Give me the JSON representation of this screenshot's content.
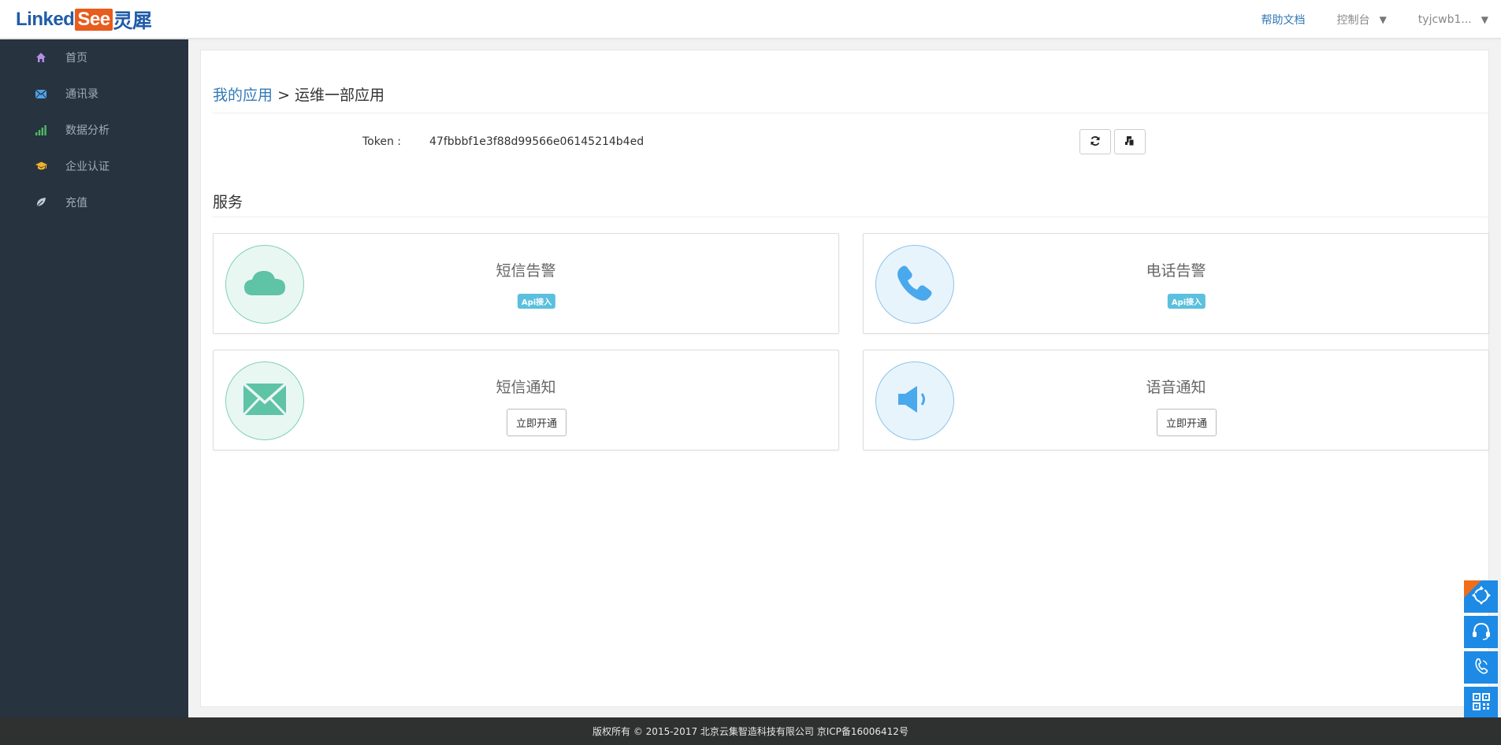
{
  "header": {
    "logo": {
      "part1": "Linked",
      "part2": "See",
      "part3": "灵犀"
    },
    "nav": {
      "help": "帮助文档",
      "console": "控制台",
      "user": "tyjcwb1..."
    }
  },
  "sidebar": {
    "items": [
      {
        "label": "首页",
        "icon": "home-icon",
        "color": "#b58fe6"
      },
      {
        "label": "通讯录",
        "icon": "envelope-icon",
        "color": "#4fa3e8"
      },
      {
        "label": "数据分析",
        "icon": "signal-bars-icon",
        "color": "#4cbb5f"
      },
      {
        "label": "企业认证",
        "icon": "graduation-cap-icon",
        "color": "#f0b429"
      },
      {
        "label": "充值",
        "icon": "leaf-icon",
        "color": "#c2ccd4"
      }
    ]
  },
  "breadcrumb": {
    "parent": "我的应用",
    "separator": ">",
    "current": "运维一部应用"
  },
  "token": {
    "label": "Token :",
    "value": "47fbbbf1e3f88d99566e06145214b4ed"
  },
  "services": {
    "title": "服务",
    "cards": [
      {
        "title": "短信告警",
        "badge": "Api接入",
        "icon": "cloud-icon"
      },
      {
        "title": "电话告警",
        "badge": "Api接入",
        "icon": "phone-icon"
      },
      {
        "title": "短信通知",
        "button": "立即开通",
        "icon": "envelope-icon"
      },
      {
        "title": "语音通知",
        "button": "立即开通",
        "icon": "speaker-icon"
      }
    ]
  },
  "footer": {
    "text": "版权所有 © 2015-2017 北京云集智造科技有限公司 京ICP备16006412号"
  },
  "colors": {
    "accent": "#337ab7",
    "sidebar": "#283340",
    "badge": "#5bc0de",
    "float": "#1d8ae5",
    "hot": "#f06d1a"
  }
}
